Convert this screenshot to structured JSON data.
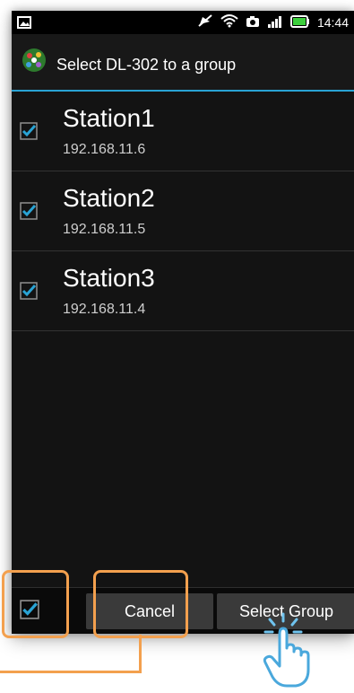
{
  "status": {
    "time": "14:44"
  },
  "header": {
    "title": "Select DL-302 to a group"
  },
  "stations": [
    {
      "name": "Station1",
      "ip": "192.168.11.6",
      "checked": true
    },
    {
      "name": "Station2",
      "ip": "192.168.11.5",
      "checked": true
    },
    {
      "name": "Station3",
      "ip": "192.168.11.4",
      "checked": true
    }
  ],
  "footer": {
    "select_all_checked": true,
    "cancel_label": "Cancel",
    "select_group_label": "Select Group"
  },
  "colors": {
    "accent": "#29a3d4",
    "callout": "#f3a04e",
    "background": "#131313"
  },
  "icons": [
    "image-icon",
    "mute-icon",
    "wifi-icon",
    "camera-icon",
    "signal-icon",
    "battery-icon",
    "app-icon",
    "checkbox-icon",
    "tap-hand-icon"
  ]
}
